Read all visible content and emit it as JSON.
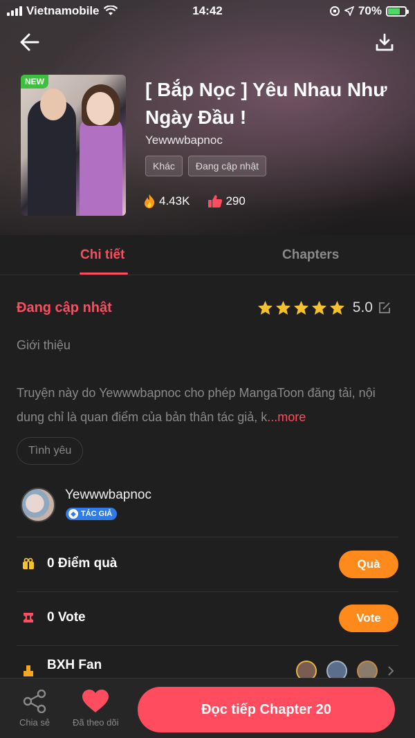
{
  "status_bar": {
    "carrier": "Vietnamobile",
    "time": "14:42",
    "battery": "70%",
    "battery_level": 0.7
  },
  "header": {
    "back_icon": "arrow-left-icon",
    "download_icon": "download-icon"
  },
  "book": {
    "badge": "NEW",
    "title": "[ Bắp Nọc ] Yêu Nhau Như Ngày Đầu !",
    "author": "Yewwwbapnoc",
    "tags": [
      "Khác",
      "Đang cập nhật"
    ],
    "views": "4.43K",
    "likes": "290"
  },
  "tabs": [
    {
      "label": "Chi tiết",
      "active": true
    },
    {
      "label": "Chapters",
      "active": false
    }
  ],
  "details": {
    "status": "Đang cập nhật",
    "rating": "5.0",
    "stars": 5,
    "intro_title": "Giới thiệu",
    "description": "Truyện này do Yewwwbapnoc cho phép MangaToon đăng tải, nội dung chỉ là quan điểm của bản thân tác giả, k",
    "more_label": "...more",
    "genre": "Tình yêu"
  },
  "author_section": {
    "name": "Yewwwbapnoc",
    "badge": "TÁC GIẢ"
  },
  "gift_row": {
    "label": "0 Điểm quà",
    "button": "Quà"
  },
  "vote_row": {
    "label": "0 Vote",
    "button": "Vote"
  },
  "fan_row": {
    "label": "BXH Fan"
  },
  "bottom_bar": {
    "share_label": "Chia sẻ",
    "follow_label": "Đã theo dõi",
    "read_label": "Đọc tiếp Chapter 20"
  },
  "colors": {
    "accent": "#ff4d5f",
    "orange": "#ff8a1c",
    "background": "#1f1f1f",
    "star": "#f5c12e"
  }
}
